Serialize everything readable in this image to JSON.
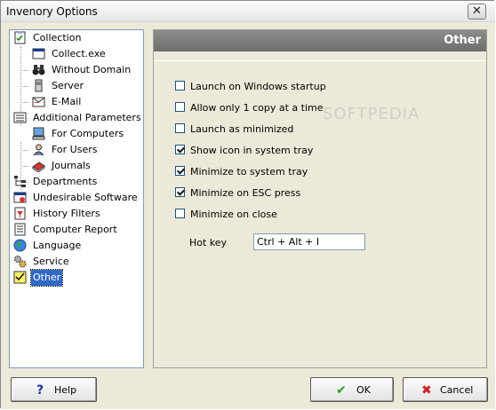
{
  "window": {
    "title": "Invenory Options"
  },
  "tree": {
    "items": [
      {
        "label": "Collection",
        "icon": "checklist-icon"
      },
      {
        "label": "Collect.exe",
        "icon": "window-icon"
      },
      {
        "label": "Without Domain",
        "icon": "binoculars-icon"
      },
      {
        "label": "Server",
        "icon": "server-icon"
      },
      {
        "label": "E-Mail",
        "icon": "email-icon"
      },
      {
        "label": "Additional Parameters",
        "icon": "parameters-icon"
      },
      {
        "label": "For Computers",
        "icon": "computer-icon"
      },
      {
        "label": "For Users",
        "icon": "user-icon"
      },
      {
        "label": "Journals",
        "icon": "journals-icon"
      },
      {
        "label": "Departments",
        "icon": "departments-icon"
      },
      {
        "label": "Undesirable Software",
        "icon": "undesirable-software-icon"
      },
      {
        "label": "History Filters",
        "icon": "history-filters-icon"
      },
      {
        "label": "Computer Report",
        "icon": "report-icon"
      },
      {
        "label": "Language",
        "icon": "globe-icon"
      },
      {
        "label": "Service",
        "icon": "gears-icon"
      },
      {
        "label": "Other",
        "icon": "checkbox-icon"
      }
    ],
    "selected": "Other"
  },
  "panel": {
    "header": "Other",
    "options": [
      {
        "label": "Launch on Windows startup",
        "checked": false
      },
      {
        "label": "Allow only 1 copy at a time",
        "checked": false
      },
      {
        "label": "Launch as minimized",
        "checked": false
      },
      {
        "label": "Show icon in system tray",
        "checked": true
      },
      {
        "label": "Minimize to system tray",
        "checked": true
      },
      {
        "label": "Minimize on ESC press",
        "checked": true
      },
      {
        "label": "Minimize on close",
        "checked": false
      }
    ],
    "hotkey": {
      "label": "Hot key",
      "value": "Ctrl + Alt + I"
    }
  },
  "watermark": "SOFTPEDIA",
  "buttons": {
    "help": "Help",
    "ok": "OK",
    "cancel": "Cancel"
  },
  "colors": {
    "selection": "#316ac5",
    "header": "#7a7a7a",
    "ok_check": "#2a9a2a",
    "cancel_x": "#cc2222"
  }
}
